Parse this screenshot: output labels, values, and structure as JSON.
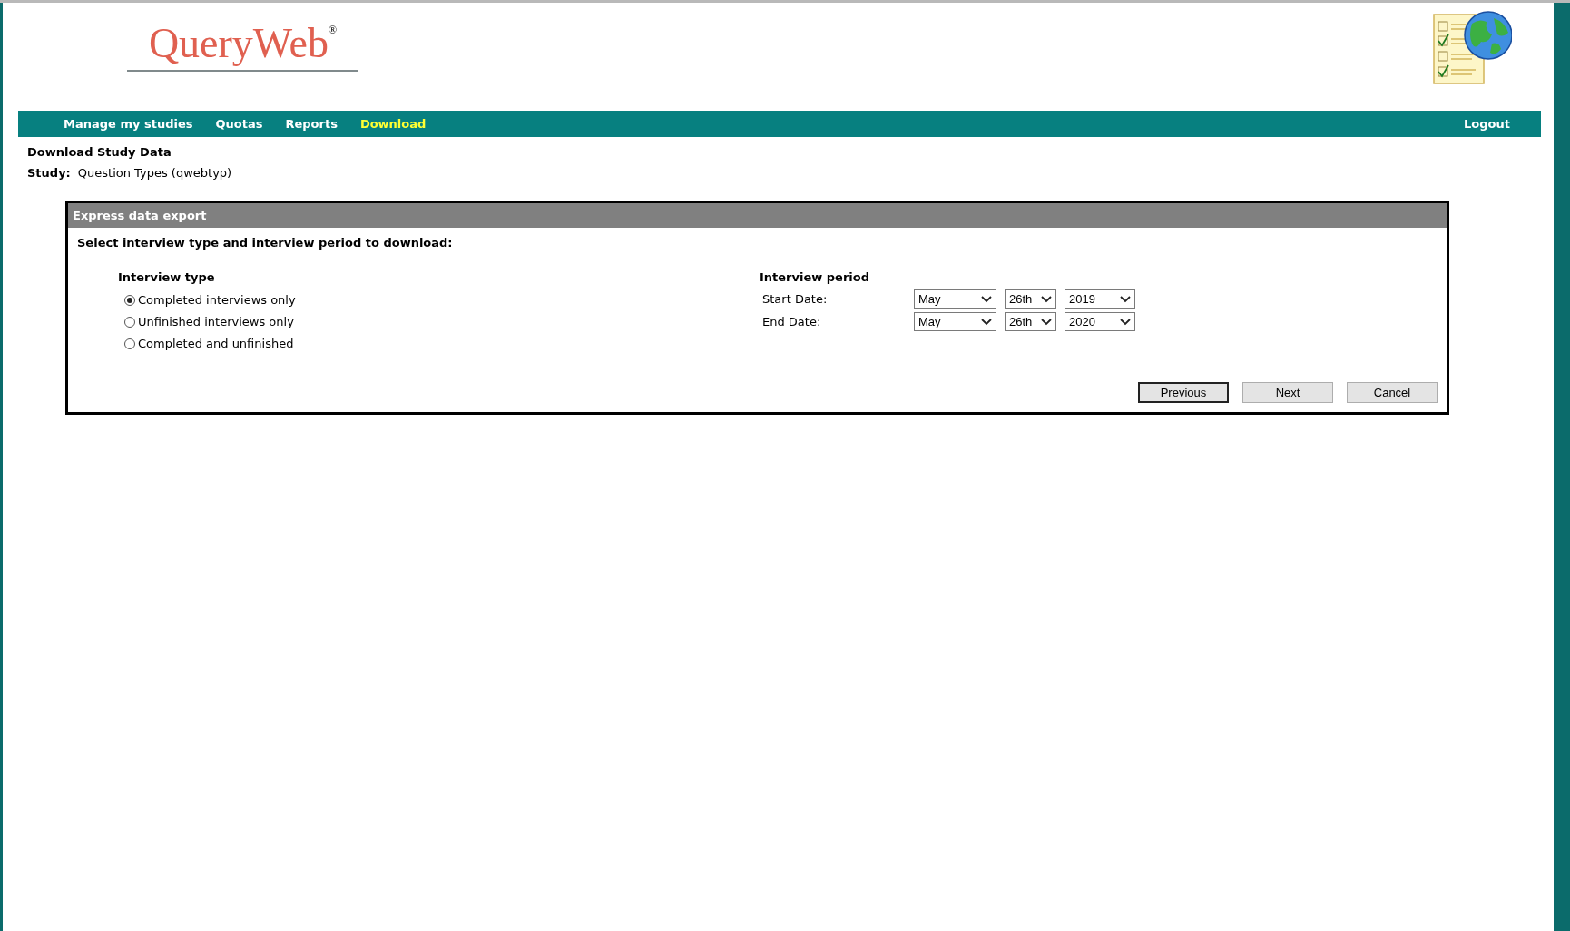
{
  "logo": {
    "name": "QueryWeb",
    "mark": "®"
  },
  "nav": {
    "items": [
      {
        "label": "Manage my studies",
        "selected": false
      },
      {
        "label": "Quotas",
        "selected": false
      },
      {
        "label": "Reports",
        "selected": false
      },
      {
        "label": "Download",
        "selected": true
      }
    ],
    "logout": "Logout"
  },
  "page": {
    "title": "Download Study Data",
    "study_label": "Study:",
    "study_value": "Question Types (qwebtyp)"
  },
  "panel": {
    "title": "Express data export",
    "instruction": "Select interview type and interview period to download:",
    "interview_type": {
      "heading": "Interview type",
      "options": [
        {
          "label": "Completed interviews only",
          "selected": true
        },
        {
          "label": "Unfinished interviews only",
          "selected": false
        },
        {
          "label": "Completed and unfinished",
          "selected": false
        }
      ]
    },
    "interview_period": {
      "heading": "Interview period",
      "rows": [
        {
          "label": "Start Date:",
          "month": "May",
          "day": "26th",
          "year": "2019"
        },
        {
          "label": "End Date:",
          "month": "May",
          "day": "26th",
          "year": "2020"
        }
      ]
    },
    "buttons": [
      {
        "label": "Previous",
        "focused": true
      },
      {
        "label": "Next",
        "focused": false
      },
      {
        "label": "Cancel",
        "focused": false
      }
    ]
  }
}
